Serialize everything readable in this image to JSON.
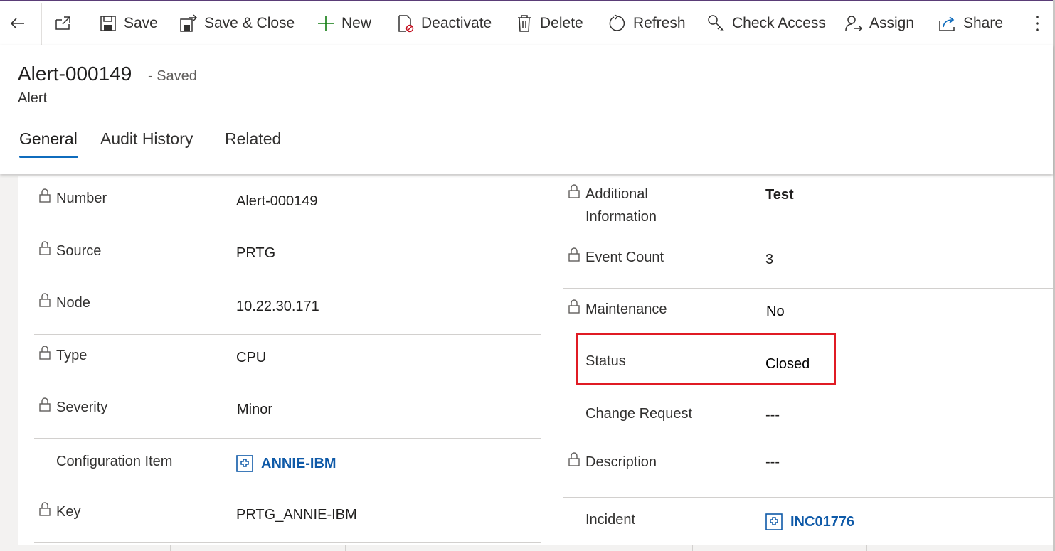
{
  "commands": {
    "save": "Save",
    "save_close": "Save & Close",
    "new": "New",
    "deactivate": "Deactivate",
    "delete": "Delete",
    "refresh": "Refresh",
    "check_access": "Check Access",
    "assign": "Assign",
    "share": "Share"
  },
  "record": {
    "title": "Alert-000149",
    "saved_status": "- Saved",
    "entity": "Alert"
  },
  "tabs": [
    "General",
    "Audit History",
    "Related"
  ],
  "left_fields": [
    {
      "label": "Number",
      "value": "Alert-000149"
    },
    {
      "label": "Source",
      "value": "PRTG"
    },
    {
      "label": "Node",
      "value": "10.22.30.171"
    },
    {
      "label": "Type",
      "value": "CPU"
    },
    {
      "label": "Severity",
      "value": "Minor"
    },
    {
      "label": "Configuration Item",
      "value": "ANNIE-IBM"
    },
    {
      "label": "Key",
      "value": "PRTG_ANNIE-IBM"
    }
  ],
  "right_fields": [
    {
      "label_line1": "Additional",
      "label_line2": "Information",
      "value": "Test"
    },
    {
      "label": "Event Count",
      "value": "3"
    },
    {
      "label": "Maintenance",
      "value": "No"
    },
    {
      "label": "Status",
      "value": "Closed"
    },
    {
      "label": "Change Request",
      "value": "---"
    },
    {
      "label": "Description",
      "value": "---"
    },
    {
      "label": "Incident",
      "value": "INC01776"
    }
  ],
  "colors": {
    "accent": "#0f6cbd",
    "link": "#0f5aa8",
    "highlight": "#e01b24"
  }
}
